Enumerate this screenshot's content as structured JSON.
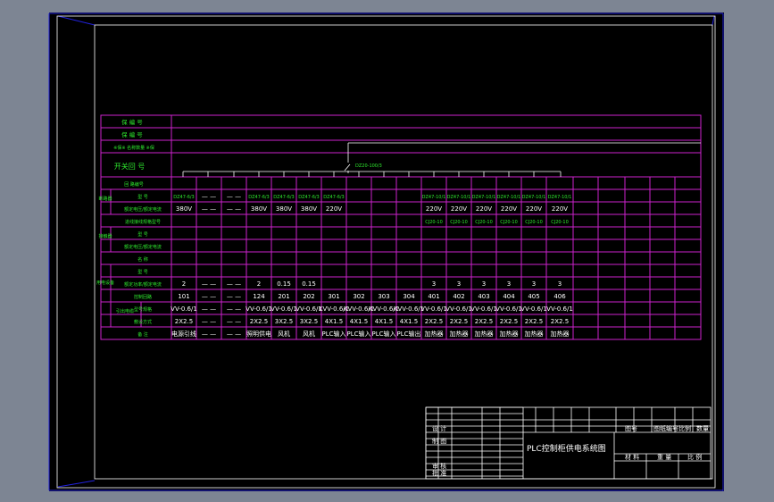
{
  "table": {
    "header_labels": [
      "保 编 号",
      "保 编 号",
      "※保※ 名称数量 ※保",
      "开关回 号",
      "回 路编号"
    ],
    "breaker_label": "DZ20-100/3",
    "row_labels": [
      "型 号",
      "额定电压/额定电流",
      "进线接线规格型号",
      "型 号",
      "额定电压/额定电流",
      "名 称",
      "型 号",
      "额定功率/额定电流",
      "控制回路",
      "型号规格",
      "敷设方式",
      "备 注"
    ],
    "group_labels": [
      "断路器",
      "接触器",
      "用电设备",
      "引出电缆"
    ],
    "rows": {
      "breaker_model": [
        "DZ47-6/3",
        "",
        "",
        "",
        "DZ47-6/3",
        "DZ47-6/3",
        "DZ47-6/3",
        "DZ47-6/3",
        "",
        "",
        "",
        "DZ47-10/1",
        "DZ47-10/1",
        "DZ47-10/1",
        "DZ47-10/1",
        "DZ47-10/1",
        "DZ47-10/1"
      ],
      "voltage": [
        "380V",
        "",
        "",
        "",
        "380V",
        "380V",
        "380V",
        "220V",
        "",
        "",
        "",
        "220V",
        "220V",
        "220V",
        "220V",
        "220V",
        "220V"
      ],
      "contactor": [
        "",
        "",
        "",
        "",
        "",
        "",
        "",
        "",
        "",
        "",
        "",
        "CJ20-10",
        "CJ20-10",
        "CJ20-10",
        "CJ20-10",
        "CJ20-10",
        "CJ20-10"
      ],
      "power": [
        "2",
        "",
        "",
        "",
        "2",
        "0.15",
        "0.15",
        "",
        "",
        "",
        "",
        "3",
        "3",
        "3",
        "3",
        "3",
        "3"
      ],
      "circuit": [
        "101",
        "",
        "",
        "",
        "124",
        "201",
        "202",
        "301",
        "302",
        "303",
        "304",
        "401",
        "402",
        "403",
        "404",
        "405",
        "406"
      ],
      "cable": [
        "VV-0.6/1",
        "",
        "",
        "",
        "VV-0.6/1",
        "VV-0.6/1",
        "VV-0.6/1",
        "KVV-0.6/1",
        "KVV-0.6/1",
        "KVV-0.6/1",
        "KVV-0.6/1",
        "VV-0.6/1",
        "VV-0.6/1",
        "VV-0.6/1",
        "VV-0.6/1",
        "VV-0.6/1",
        "VV-0.6/1"
      ],
      "size": [
        "2X2.5",
        "",
        "",
        "",
        "2X2.5",
        "3X2.5",
        "3X2.5",
        "4X1.5",
        "4X1.5",
        "4X1.5",
        "4X1.5",
        "2X2.5",
        "2X2.5",
        "2X2.5",
        "2X2.5",
        "2X2.5",
        "2X2.5"
      ],
      "note": [
        "电源引线",
        "",
        "",
        "",
        "照明供电",
        "风机",
        "风机",
        "PLC输入",
        "PLC输入",
        "PLC输入",
        "PLC输出",
        "加热器",
        "加热器",
        "加热器",
        "加热器",
        "加热器",
        "加热器"
      ]
    },
    "dash_text": "— —"
  },
  "title_block": {
    "drawing_title": "PLC控制柜供电系统图",
    "labels_left": [
      "设 计",
      "制 图",
      "审 核",
      "批 准"
    ],
    "labels_right_top": [
      "图号",
      "图纸编号",
      "比例",
      "数量"
    ],
    "labels_right_bottom": [
      "材 料",
      "重 量",
      "比 例"
    ]
  },
  "colors": {
    "background": "#000000",
    "line": "#cc22cc",
    "text": "#2ee82e",
    "frame": "#ffffff",
    "outer": "#7d8593"
  }
}
